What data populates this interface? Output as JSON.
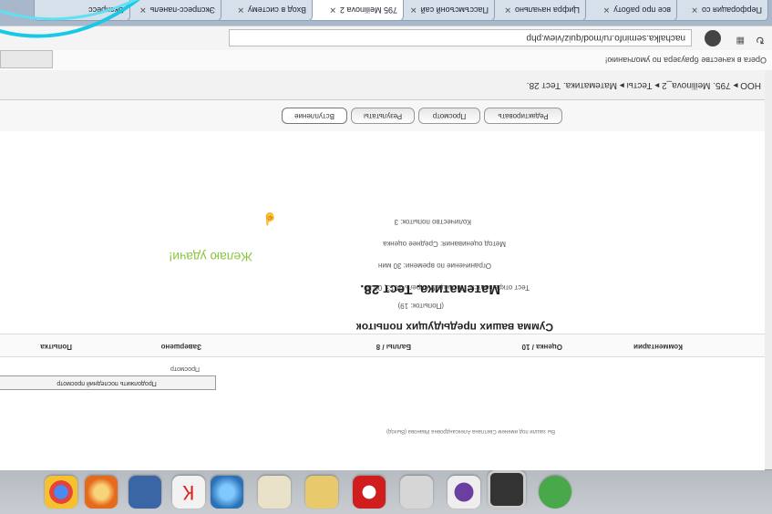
{
  "browser": {
    "url": "nachalka.seminfo.ru/mod/quiz/view.php",
    "default_browser_prompt": "Opera в качестве браузера по умолчанию!",
    "tabs": [
      {
        "label": "Перфорация со"
      },
      {
        "label": "все про работу"
      },
      {
        "label": "Цифра начально"
      },
      {
        "label": "Пассъмсъонй сай"
      },
      {
        "label": "795 Meilinova 2"
      },
      {
        "label": "Вход в систему"
      },
      {
        "label": "Экспресс-панель"
      },
      {
        "label": "Экспресс"
      }
    ]
  },
  "breadcrumb": {
    "text": "НОО ▸ 795. Meilinova_2 ▸ Тесты ▸ Математика. Тест 28."
  },
  "nav_tabs": [
    "Вступление",
    "Результаты",
    "Просмотр",
    "Редактировать"
  ],
  "quiz": {
    "title": "Математика. Тест 28.",
    "wish_text": "Желаю удачи!",
    "attempts_allowed": "Количество попыток: 3",
    "grading_method": "Метод оценивания: Среднее оценка",
    "time_limit": "Ограничение по времени: 30 мин",
    "opened": "Тест открывается: Пятница 5 Апрель 2013, 00:30",
    "attempts_count": "(Попыток: 19)",
    "summary_title": "Сумма ваших предыдущих попыток"
  },
  "attempts_table": {
    "headers": [
      "Попытка",
      "Завершено",
      "Баллы / 8",
      "Оценка / 10",
      "Комментарии"
    ],
    "row_label": "Просмотр"
  },
  "show_review_button": "Продолжить последний просмотр",
  "footer": "Вы зашли под именем Светлана Александровна Иванова (Выход)",
  "colors": {
    "wish_green": "#8cc63f"
  }
}
